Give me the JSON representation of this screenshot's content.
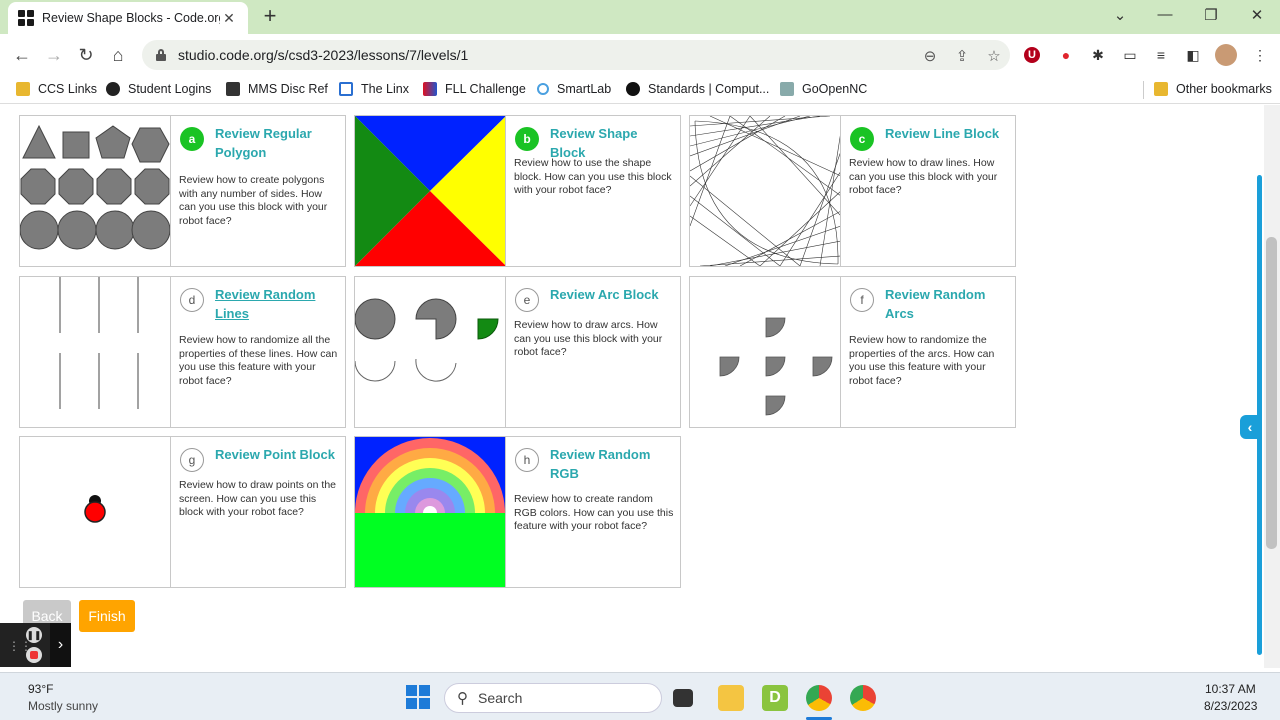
{
  "browser": {
    "tab_title": "Review Shape Blocks - Code.org",
    "url": "studio.code.org/s/csd3-2023/lessons/7/levels/1",
    "bookmarks": [
      "CCS Links",
      "Student Logins",
      "MMS Disc Ref",
      "The Linx",
      "FLL Challenge",
      "SmartLab",
      "Standards | Comput...",
      "GoOpenNC"
    ],
    "other_bookmarks": "Other bookmarks",
    "colors": {
      "tabstrip": "#cfe8c2",
      "accent": "#2ba8ae",
      "done": "#1ac324"
    }
  },
  "cards": [
    {
      "letter": "a",
      "title": "Review Regular Polygon",
      "desc": "Review how to create polygons with any number of sides. How can you use this block with your robot face?",
      "status": "done"
    },
    {
      "letter": "b",
      "title": "Review Shape Block",
      "desc": "Review how to use the shape block. How can you use this block with your robot face?",
      "status": "done"
    },
    {
      "letter": "c",
      "title": "Review Line Block",
      "desc": "Review how to draw lines. How can you use this block with your robot face?",
      "status": "done"
    },
    {
      "letter": "d",
      "title": "Review Random Lines",
      "desc": "Review how to randomize all the properties of these lines. How can you use this feature with your robot face?",
      "status": "todo"
    },
    {
      "letter": "e",
      "title": "Review Arc Block",
      "desc": "Review how to draw arcs. How can you use this block with your robot face?",
      "status": "todo"
    },
    {
      "letter": "f",
      "title": "Review Random Arcs",
      "desc": "Review how to randomize the properties of the arcs. How can you use this feature with your robot face?",
      "status": "todo"
    },
    {
      "letter": "g",
      "title": "Review Point Block",
      "desc": "Review how to draw points on the screen. How can you use this block with your robot face?",
      "status": "todo"
    },
    {
      "letter": "h",
      "title": "Review Random RGB",
      "desc": "Review how to create random RGB colors. How can you use this feature with your robot face?",
      "status": "todo"
    }
  ],
  "buttons": {
    "back": "Back",
    "finish": "Finish"
  },
  "taskbar": {
    "temp": "93°F",
    "weather": "Mostly sunny",
    "search": "Search",
    "time": "10:37 AM",
    "date": "8/23/2023"
  }
}
